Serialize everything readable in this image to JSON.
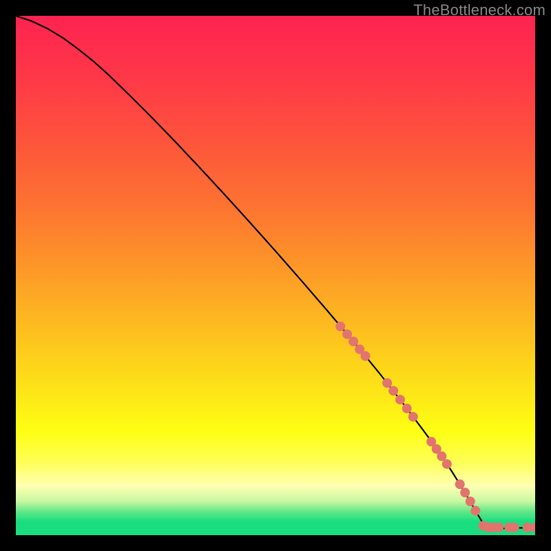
{
  "watermark": "TheBottleneck.com",
  "colors": {
    "background": "#000000",
    "curve": "#000000",
    "point_fill": "#e2746d",
    "point_stroke": "#e2746d",
    "bottom_line": "#19dd7f",
    "gradient_stops": [
      {
        "offset": 0.0,
        "color": "#fe2351"
      },
      {
        "offset": 0.12,
        "color": "#fe3847"
      },
      {
        "offset": 0.25,
        "color": "#fd563b"
      },
      {
        "offset": 0.38,
        "color": "#fd7730"
      },
      {
        "offset": 0.5,
        "color": "#fd9c27"
      },
      {
        "offset": 0.62,
        "color": "#fdc31e"
      },
      {
        "offset": 0.72,
        "color": "#fde418"
      },
      {
        "offset": 0.8,
        "color": "#fefe14"
      },
      {
        "offset": 0.86,
        "color": "#feff57"
      },
      {
        "offset": 0.905,
        "color": "#ffffb2"
      },
      {
        "offset": 0.935,
        "color": "#c8f7a2"
      },
      {
        "offset": 0.955,
        "color": "#5fe886"
      },
      {
        "offset": 0.975,
        "color": "#19dd7f"
      },
      {
        "offset": 1.0,
        "color": "#19dd7f"
      }
    ]
  },
  "chart_data": {
    "type": "line",
    "title": "",
    "xlabel": "",
    "ylabel": "",
    "xlim": [
      0,
      100
    ],
    "ylim": [
      0,
      100
    ],
    "series": [
      {
        "name": "curve",
        "x": [
          0,
          3,
          6,
          9,
          12,
          15,
          18,
          22,
          26,
          30,
          35,
          40,
          45,
          50,
          55,
          60,
          65,
          70,
          75,
          78,
          80,
          82,
          84,
          86,
          88,
          90,
          92,
          94,
          96,
          98,
          100
        ],
        "y": [
          100,
          99.0,
          97.6,
          95.8,
          93.6,
          91.2,
          88.5,
          84.6,
          80.6,
          76.5,
          71.2,
          65.8,
          60.3,
          54.7,
          49.0,
          43.2,
          37.3,
          31.2,
          24.8,
          20.8,
          18.1,
          15.2,
          12.2,
          9.0,
          5.6,
          2.2,
          1.2,
          1.3,
          1.4,
          1.4,
          1.5
        ]
      }
    ],
    "points": [
      {
        "x": 62.5,
        "y": 40.2
      },
      {
        "x": 63.8,
        "y": 38.7
      },
      {
        "x": 65.0,
        "y": 37.3
      },
      {
        "x": 66.2,
        "y": 35.8
      },
      {
        "x": 67.3,
        "y": 34.5
      },
      {
        "x": 71.5,
        "y": 29.3
      },
      {
        "x": 72.7,
        "y": 27.8
      },
      {
        "x": 74.0,
        "y": 26.1
      },
      {
        "x": 75.3,
        "y": 24.4
      },
      {
        "x": 76.5,
        "y": 22.8
      },
      {
        "x": 80.0,
        "y": 18.0
      },
      {
        "x": 81.0,
        "y": 16.6
      },
      {
        "x": 82.0,
        "y": 15.2
      },
      {
        "x": 83.0,
        "y": 13.7
      },
      {
        "x": 85.5,
        "y": 9.8
      },
      {
        "x": 86.5,
        "y": 8.2
      },
      {
        "x": 87.5,
        "y": 6.5
      },
      {
        "x": 88.5,
        "y": 4.7
      },
      {
        "x": 90.0,
        "y": 1.8
      },
      {
        "x": 91.0,
        "y": 1.5
      },
      {
        "x": 92.0,
        "y": 1.5
      },
      {
        "x": 93.0,
        "y": 1.5
      },
      {
        "x": 95.0,
        "y": 1.5
      },
      {
        "x": 96.0,
        "y": 1.5
      },
      {
        "x": 98.5,
        "y": 1.5
      },
      {
        "x": 100.0,
        "y": 1.5
      }
    ]
  }
}
